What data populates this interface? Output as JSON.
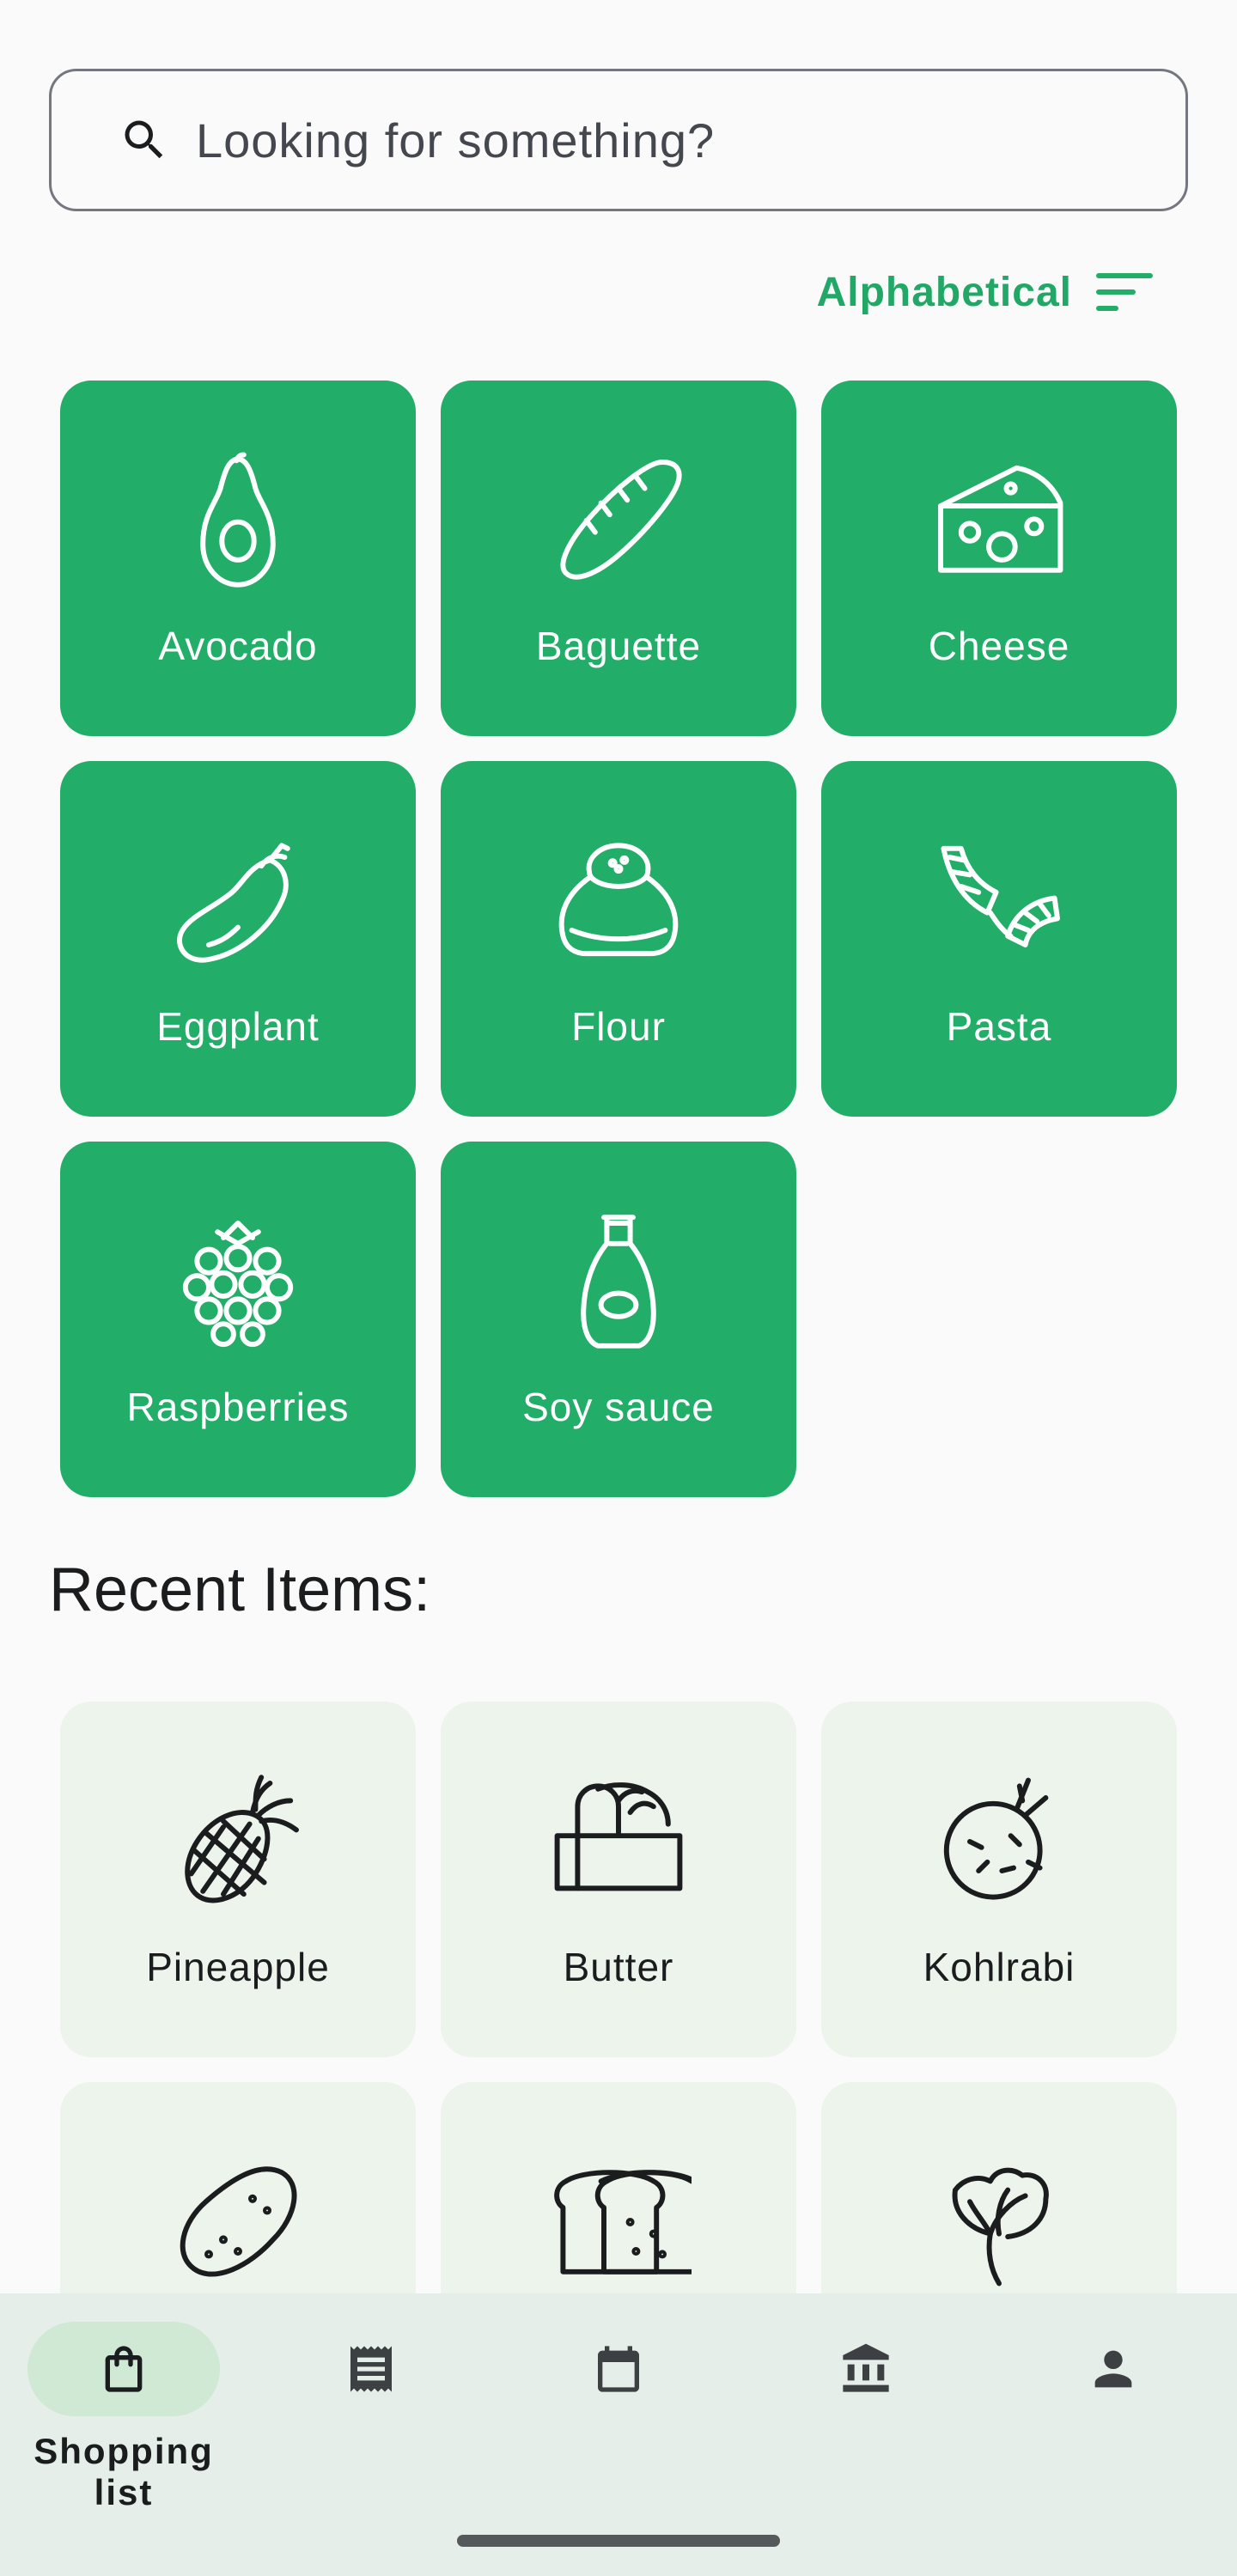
{
  "search": {
    "placeholder": "Looking for something?",
    "icon": "search-icon"
  },
  "sort": {
    "label": "Alphabetical",
    "icon": "sort-icon"
  },
  "catalog": {
    "items": [
      {
        "label": "Avocado",
        "icon": "avocado-icon"
      },
      {
        "label": "Baguette",
        "icon": "baguette-icon"
      },
      {
        "label": "Cheese",
        "icon": "cheese-icon"
      },
      {
        "label": "Eggplant",
        "icon": "eggplant-icon"
      },
      {
        "label": "Flour",
        "icon": "flour-icon"
      },
      {
        "label": "Pasta",
        "icon": "pasta-icon"
      },
      {
        "label": "Raspberries",
        "icon": "raspberries-icon"
      },
      {
        "label": "Soy sauce",
        "icon": "soy-sauce-icon"
      }
    ]
  },
  "recent": {
    "title": "Recent Items:",
    "items": [
      {
        "label": "Pineapple",
        "icon": "pineapple-icon"
      },
      {
        "label": "Butter",
        "icon": "butter-icon"
      },
      {
        "label": "Kohlrabi",
        "icon": "kohlrabi-icon"
      },
      {
        "label": "",
        "icon": "potato-icon"
      },
      {
        "label": "",
        "icon": "bread-icon"
      },
      {
        "label": "",
        "icon": "lettuce-icon"
      }
    ]
  },
  "nav": {
    "items": [
      {
        "label": "Shopping list",
        "icon": "shopping-bag-icon",
        "active": true
      },
      {
        "label": "",
        "icon": "receipt-icon",
        "active": false
      },
      {
        "label": "",
        "icon": "calendar-icon",
        "active": false
      },
      {
        "label": "",
        "icon": "bank-icon",
        "active": false
      },
      {
        "label": "",
        "icon": "person-icon",
        "active": false
      }
    ]
  },
  "colors": {
    "accent": "#22ad68",
    "tile_light": "#edf4ec",
    "nav_background": "#e6eeea",
    "nav_active_pill": "#cfe9d4",
    "text": "#1a1c1e"
  }
}
